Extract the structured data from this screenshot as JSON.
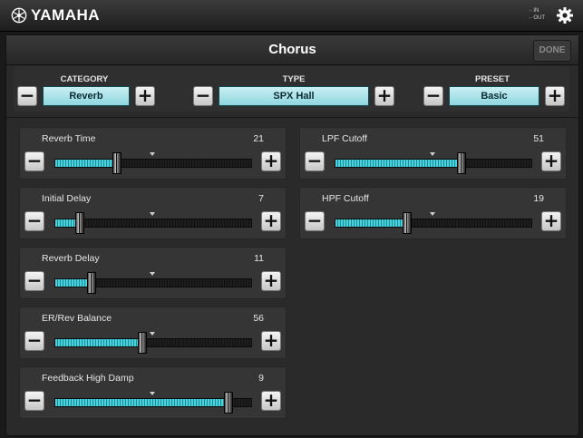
{
  "app": {
    "brand": "YAMAHA",
    "io_in": "IN",
    "io_out": "OUT"
  },
  "panel": {
    "title": "Chorus",
    "done_label": "DONE"
  },
  "selectors": [
    {
      "label": "CATEGORY",
      "value": "Reverb"
    },
    {
      "label": "TYPE",
      "value": "SPX Hall"
    },
    {
      "label": "PRESET",
      "value": "Basic"
    }
  ],
  "controls": {
    "minus": "−",
    "plus": "+"
  },
  "params": [
    {
      "label": "Reverb Time",
      "value": "21",
      "level": 0.31
    },
    {
      "label": "Initial Delay",
      "value": "7",
      "level": 0.12
    },
    {
      "label": "Reverb Delay",
      "value": "11",
      "level": 0.18
    },
    {
      "label": "ER/Rev Balance",
      "value": "56",
      "level": 0.44
    },
    {
      "label": "Feedback High Damp",
      "value": "9",
      "level": 0.88
    },
    {
      "label": "LPF Cutoff",
      "value": "51",
      "level": 0.64
    },
    {
      "label": "HPF Cutoff",
      "value": "19",
      "level": 0.36
    }
  ],
  "colors": {
    "accent": "#48d3de",
    "value_bg": "#a9e3ea"
  }
}
